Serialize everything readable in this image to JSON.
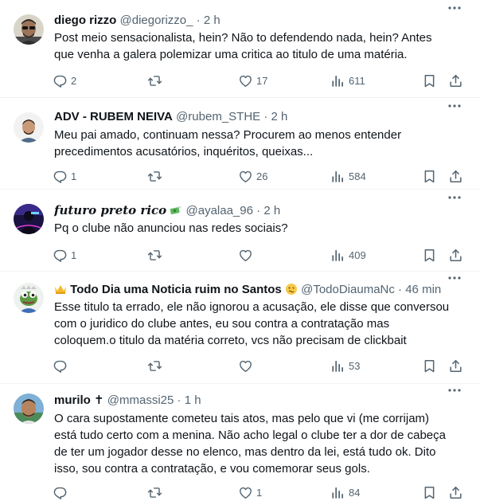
{
  "tweets": [
    {
      "name": "diego rizzo",
      "handle": "@diegorizzo_",
      "dot": "·",
      "time": "2 h",
      "text": "Post meio sensacionalista, hein? Não to defendendo nada, hein? Antes\nque venha a galera polemizar uma critica ao titulo de uma matéria.",
      "replies": "2",
      "retweets": "",
      "likes": "17",
      "views": "611",
      "avatar_icon": "avatar-man-sunglasses"
    },
    {
      "name": "ADV - RUBEM NEIVA",
      "handle": "@rubem_STHE",
      "dot": "·",
      "time": "2 h",
      "text": "Meu pai amado, continuam nessa? Procurem ao menos entender\nprecedimentos acusatórios, inquéritos, queixas...",
      "replies": "1",
      "retweets": "",
      "likes": "26",
      "views": "584",
      "avatar_icon": "avatar-man-cartoon"
    },
    {
      "name": "futuro preto rico",
      "handle": "@ayalaa_96",
      "dot": "·",
      "time": "2 h",
      "text": "Pq o clube não anunciou nas redes sociais?",
      "replies": "1",
      "retweets": "",
      "likes": "",
      "views": "409",
      "avatar_icon": "avatar-neon-figure",
      "name_emoji": "money-with-wings-emoji"
    },
    {
      "name": "Todo Dia uma Noticia ruim no Santos",
      "handle": "@TodoDiaumaNc",
      "dot": "·",
      "time": "46 min",
      "text": "Esse titulo ta errado, ele não  ignorou a acusação,  ele disse que conversou\ncom o juridico do clube antes, eu sou contra a contratação  mas\ncoloquem.o titulo da matéria correto, vcs não  precisam de clickbait",
      "replies": "",
      "retweets": "",
      "likes": "",
      "views": "53",
      "avatar_icon": "avatar-pepe-frog",
      "name_emoji_before": "crown-emoji",
      "name_emoji_after": "woozy-face-emoji"
    },
    {
      "name": "murilo",
      "handle": "@mmassi25",
      "dot": "·",
      "time": "1 h",
      "text": "O cara supostamente cometeu tais atos, mas pelo que vi (me corrijam)\nestá tudo certo com a menina. Não acho legal o clube ter a dor de cabeça\nde ter um jogador desse no elenco, mas dentro da lei, está tudo ok. Dito\nisso, sou contra a contratação, e vou comemorar seus gols.",
      "replies": "",
      "retweets": "",
      "likes": "1",
      "views": "84",
      "avatar_icon": "avatar-man-selfie",
      "name_symbol": "✝"
    }
  ],
  "colors": {
    "text": "#0f1419",
    "secondary": "#536471",
    "divider": "#eff3f4"
  },
  "icons": [
    "reply-icon",
    "retweet-icon",
    "like-icon",
    "views-icon",
    "bookmark-icon",
    "share-icon",
    "more-icon"
  ]
}
